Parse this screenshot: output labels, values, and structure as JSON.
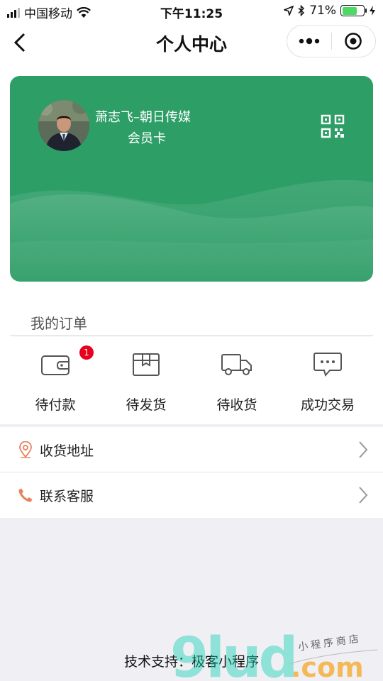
{
  "status_bar": {
    "carrier": "中国移动",
    "time": "下午11:25",
    "battery": "71%",
    "battery_level": 0.71
  },
  "nav": {
    "title": "个人中心"
  },
  "member_card": {
    "name": "萧志飞–朝日传媒",
    "card_type": "会员卡",
    "color": "#2e9e67"
  },
  "orders": {
    "title": "我的订单",
    "items": [
      {
        "label": "待付款",
        "icon": "wallet-icon",
        "badge": "1"
      },
      {
        "label": "待发货",
        "icon": "package-icon"
      },
      {
        "label": "待收货",
        "icon": "truck-icon"
      },
      {
        "label": "成功交易",
        "icon": "chat-icon"
      }
    ]
  },
  "menu": [
    {
      "label": "收货地址",
      "icon": "location-pin-icon"
    },
    {
      "label": "联系客服",
      "icon": "phone-icon"
    }
  ],
  "footer": {
    "text": "技术支持：极客小程序"
  },
  "watermark": {
    "brand": "9lud",
    "domain": ".com",
    "tagline": "小程序商店"
  },
  "colors": {
    "accent": "#2e9e67",
    "badge": "#e8001c",
    "icon_orange": "#e8825c"
  }
}
